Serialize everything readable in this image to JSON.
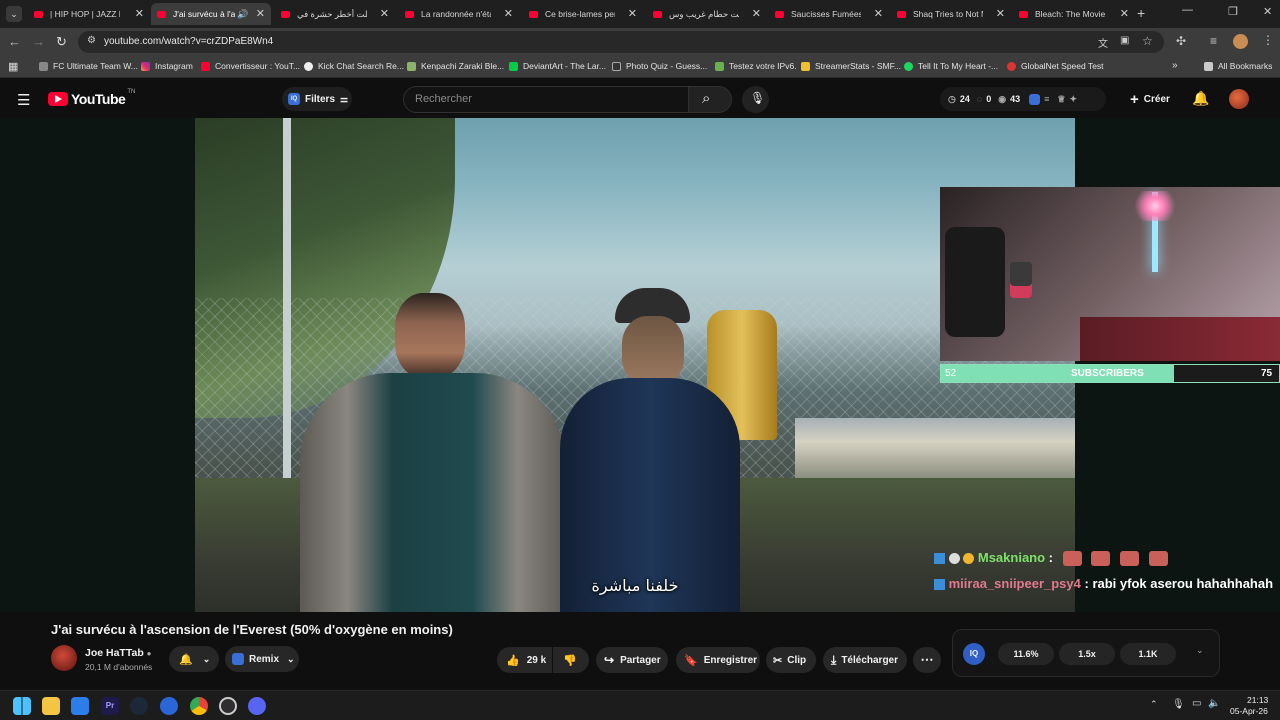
{
  "browser": {
    "tabs": [
      {
        "title": "| HIP HOP | JAZZ RAP",
        "active": false
      },
      {
        "title": "J'ai survécu à l'asc",
        "active": true
      },
      {
        "title": "أكلت أخطر حشرة في",
        "active": false
      },
      {
        "title": "La randonnée n'était",
        "active": false
      },
      {
        "title": "Ce brise-lames perm",
        "active": false
      },
      {
        "title": "دخلت حطام غريب وس",
        "active": false
      },
      {
        "title": "Saucisses Fumées No",
        "active": false
      },
      {
        "title": "Shaq Tries to Not Ma",
        "active": false
      },
      {
        "title": "Bleach: The Movie (2",
        "active": false
      }
    ],
    "url": "youtube.com/watch?v=crZDPaE8Wn4",
    "bookmarks": [
      "FC Ultimate Team W...",
      "Instagram",
      "Convertisseur : YouT...",
      "Kick Chat Search Re...",
      "Kenpachi Zaraki Ble...",
      "DeviantArt - The Lar...",
      "Photo Quiz - Guess...",
      "Testez votre IPv6.",
      "StreamerStats - SMF...",
      "Tell It To My Heart -...",
      "GlobalNet Speed Test"
    ],
    "all_bookmarks": "All Bookmarks"
  },
  "youtube": {
    "logo": "YouTube",
    "logo_sup": "TN",
    "filters": "Filters",
    "search_placeholder": "Rechercher",
    "stats": {
      "a": "24",
      "b": "0",
      "c": "43"
    },
    "create": "Créer"
  },
  "video": {
    "subtitle": "خلفنا مباشرة",
    "title": "J'ai survécu à l'ascension de l'Everest (50% d'oxygène en moins)",
    "channel": "Joe HaTTab",
    "subscribers": "20,1 M d'abonnés",
    "remix": "Remix",
    "likes": "29 k",
    "share": "Partager",
    "save": "Enregistrer",
    "clip": "Clip",
    "download": "Télécharger"
  },
  "iq_panel": {
    "badge": "IQ",
    "v1": "11.6%",
    "v2": "1.5x",
    "v3": "1.1K"
  },
  "stream": {
    "subs_current": "52",
    "subs_label": "SUBSCRIBERS",
    "subs_goal": "75",
    "subs_progress": 0.69,
    "chat": [
      {
        "user": "Msakniano",
        "sep": " :",
        "text": "",
        "color": "#7ee06a"
      },
      {
        "user": "miiraa_sniipeer_psy4",
        "sep": " :",
        "text": " rabi yfok aserou hahahhahah",
        "color": "#e07a8c"
      }
    ]
  },
  "taskbar": {
    "time": "21:13",
    "date": "05-Apr-26"
  }
}
